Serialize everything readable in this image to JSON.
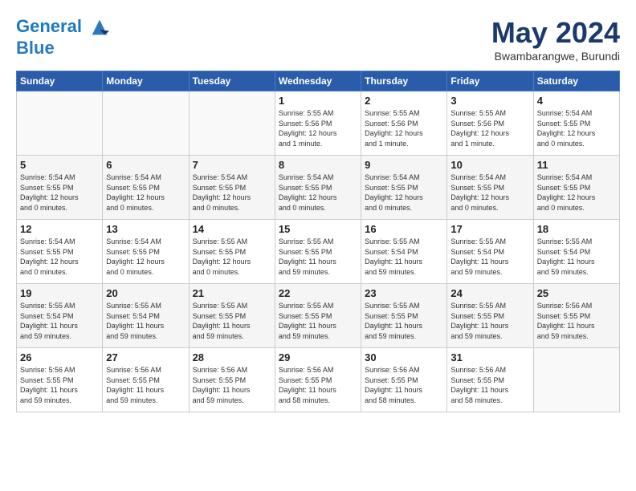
{
  "logo": {
    "line1": "General",
    "line2": "Blue"
  },
  "title": "May 2024",
  "subtitle": "Bwambarangwe, Burundi",
  "headers": [
    "Sunday",
    "Monday",
    "Tuesday",
    "Wednesday",
    "Thursday",
    "Friday",
    "Saturday"
  ],
  "weeks": [
    [
      {
        "num": "",
        "info": ""
      },
      {
        "num": "",
        "info": ""
      },
      {
        "num": "",
        "info": ""
      },
      {
        "num": "1",
        "info": "Sunrise: 5:55 AM\nSunset: 5:56 PM\nDaylight: 12 hours\nand 1 minute."
      },
      {
        "num": "2",
        "info": "Sunrise: 5:55 AM\nSunset: 5:56 PM\nDaylight: 12 hours\nand 1 minute."
      },
      {
        "num": "3",
        "info": "Sunrise: 5:55 AM\nSunset: 5:56 PM\nDaylight: 12 hours\nand 1 minute."
      },
      {
        "num": "4",
        "info": "Sunrise: 5:54 AM\nSunset: 5:55 PM\nDaylight: 12 hours\nand 0 minutes."
      }
    ],
    [
      {
        "num": "5",
        "info": "Sunrise: 5:54 AM\nSunset: 5:55 PM\nDaylight: 12 hours\nand 0 minutes."
      },
      {
        "num": "6",
        "info": "Sunrise: 5:54 AM\nSunset: 5:55 PM\nDaylight: 12 hours\nand 0 minutes."
      },
      {
        "num": "7",
        "info": "Sunrise: 5:54 AM\nSunset: 5:55 PM\nDaylight: 12 hours\nand 0 minutes."
      },
      {
        "num": "8",
        "info": "Sunrise: 5:54 AM\nSunset: 5:55 PM\nDaylight: 12 hours\nand 0 minutes."
      },
      {
        "num": "9",
        "info": "Sunrise: 5:54 AM\nSunset: 5:55 PM\nDaylight: 12 hours\nand 0 minutes."
      },
      {
        "num": "10",
        "info": "Sunrise: 5:54 AM\nSunset: 5:55 PM\nDaylight: 12 hours\nand 0 minutes."
      },
      {
        "num": "11",
        "info": "Sunrise: 5:54 AM\nSunset: 5:55 PM\nDaylight: 12 hours\nand 0 minutes."
      }
    ],
    [
      {
        "num": "12",
        "info": "Sunrise: 5:54 AM\nSunset: 5:55 PM\nDaylight: 12 hours\nand 0 minutes."
      },
      {
        "num": "13",
        "info": "Sunrise: 5:54 AM\nSunset: 5:55 PM\nDaylight: 12 hours\nand 0 minutes."
      },
      {
        "num": "14",
        "info": "Sunrise: 5:55 AM\nSunset: 5:55 PM\nDaylight: 12 hours\nand 0 minutes."
      },
      {
        "num": "15",
        "info": "Sunrise: 5:55 AM\nSunset: 5:55 PM\nDaylight: 11 hours\nand 59 minutes."
      },
      {
        "num": "16",
        "info": "Sunrise: 5:55 AM\nSunset: 5:54 PM\nDaylight: 11 hours\nand 59 minutes."
      },
      {
        "num": "17",
        "info": "Sunrise: 5:55 AM\nSunset: 5:54 PM\nDaylight: 11 hours\nand 59 minutes."
      },
      {
        "num": "18",
        "info": "Sunrise: 5:55 AM\nSunset: 5:54 PM\nDaylight: 11 hours\nand 59 minutes."
      }
    ],
    [
      {
        "num": "19",
        "info": "Sunrise: 5:55 AM\nSunset: 5:54 PM\nDaylight: 11 hours\nand 59 minutes."
      },
      {
        "num": "20",
        "info": "Sunrise: 5:55 AM\nSunset: 5:54 PM\nDaylight: 11 hours\nand 59 minutes."
      },
      {
        "num": "21",
        "info": "Sunrise: 5:55 AM\nSunset: 5:55 PM\nDaylight: 11 hours\nand 59 minutes."
      },
      {
        "num": "22",
        "info": "Sunrise: 5:55 AM\nSunset: 5:55 PM\nDaylight: 11 hours\nand 59 minutes."
      },
      {
        "num": "23",
        "info": "Sunrise: 5:55 AM\nSunset: 5:55 PM\nDaylight: 11 hours\nand 59 minutes."
      },
      {
        "num": "24",
        "info": "Sunrise: 5:55 AM\nSunset: 5:55 PM\nDaylight: 11 hours\nand 59 minutes."
      },
      {
        "num": "25",
        "info": "Sunrise: 5:56 AM\nSunset: 5:55 PM\nDaylight: 11 hours\nand 59 minutes."
      }
    ],
    [
      {
        "num": "26",
        "info": "Sunrise: 5:56 AM\nSunset: 5:55 PM\nDaylight: 11 hours\nand 59 minutes."
      },
      {
        "num": "27",
        "info": "Sunrise: 5:56 AM\nSunset: 5:55 PM\nDaylight: 11 hours\nand 59 minutes."
      },
      {
        "num": "28",
        "info": "Sunrise: 5:56 AM\nSunset: 5:55 PM\nDaylight: 11 hours\nand 59 minutes."
      },
      {
        "num": "29",
        "info": "Sunrise: 5:56 AM\nSunset: 5:55 PM\nDaylight: 11 hours\nand 58 minutes."
      },
      {
        "num": "30",
        "info": "Sunrise: 5:56 AM\nSunset: 5:55 PM\nDaylight: 11 hours\nand 58 minutes."
      },
      {
        "num": "31",
        "info": "Sunrise: 5:56 AM\nSunset: 5:55 PM\nDaylight: 11 hours\nand 58 minutes."
      },
      {
        "num": "",
        "info": ""
      }
    ]
  ]
}
